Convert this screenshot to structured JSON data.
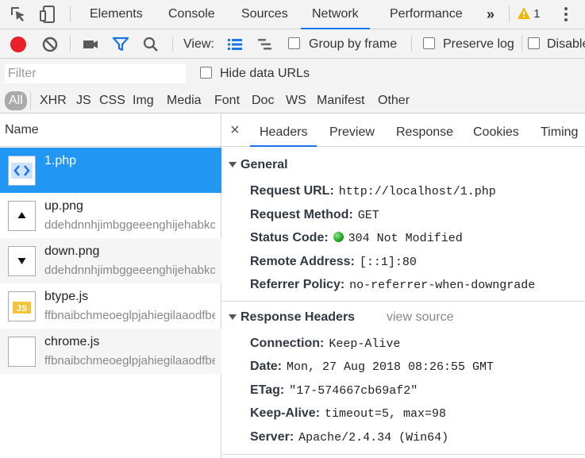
{
  "main_tabs": [
    {
      "label": "Elements"
    },
    {
      "label": "Console"
    },
    {
      "label": "Sources"
    },
    {
      "label": "Network"
    },
    {
      "label": "Performance"
    }
  ],
  "more_tabs_glyph": "»",
  "warning_count": "1",
  "toolbar": {
    "view_label": "View:",
    "group_by_frame": "Group by frame",
    "preserve_log": "Preserve log",
    "disable_cache": "Disable cache"
  },
  "filter": {
    "placeholder": "Filter",
    "hide_data_urls": "Hide data URLs"
  },
  "type_filters": [
    "All",
    "XHR",
    "JS",
    "CSS",
    "Img",
    "Media",
    "Font",
    "Doc",
    "WS",
    "Manifest",
    "Other"
  ],
  "list": {
    "header": "Name",
    "requests": [
      {
        "name": "1.php",
        "sub": "",
        "icon": "code-icon"
      },
      {
        "name": "up.png",
        "sub": "ddehdnnhjimbggeeenghijehabkcmhdmlkjdabk",
        "icon": "up-arrow-image-icon"
      },
      {
        "name": "down.png",
        "sub": "ddehdnnhjimbggeeenghijehabkcmhdmlkjdabk",
        "icon": "down-arrow-image-icon"
      },
      {
        "name": "btype.js",
        "sub": "ffbnaibchmeoeglpjahiegilaaodfbelbpdkgj",
        "icon": "js-file-icon"
      },
      {
        "name": "chrome.js",
        "sub": "ffbnaibchmeoeglpjahiegilaaodfbelbpdkgj",
        "icon": "blank-file-icon"
      }
    ]
  },
  "detail": {
    "close_glyph": "×",
    "tabs": [
      "Headers",
      "Preview",
      "Response",
      "Cookies",
      "Timing"
    ],
    "general": {
      "title": "General",
      "rows": [
        {
          "key": "Request URL:",
          "value": "http://localhost/1.php"
        },
        {
          "key": "Request Method:",
          "value": "GET"
        },
        {
          "key": "Status Code:",
          "value": "304 Not Modified"
        },
        {
          "key": "Remote Address:",
          "value": "[::1]:80"
        },
        {
          "key": "Referrer Policy:",
          "value": "no-referrer-when-downgrade"
        }
      ]
    },
    "response_headers": {
      "title": "Response Headers",
      "view_source": "view source",
      "rows": [
        {
          "key": "Connection:",
          "value": "Keep-Alive"
        },
        {
          "key": "Date:",
          "value": "Mon, 27 Aug 2018 08:26:55 GMT"
        },
        {
          "key": "ETag:",
          "value": "\"17-574667cb69af2\""
        },
        {
          "key": "Keep-Alive:",
          "value": "timeout=5, max=98"
        },
        {
          "key": "Server:",
          "value": "Apache/2.4.34 (Win64)"
        }
      ]
    }
  },
  "colors": {
    "accent": "#1a73e8",
    "selected_row": "#2196f3",
    "record": "#e8202a",
    "filter_icon": "#1a73e8"
  }
}
